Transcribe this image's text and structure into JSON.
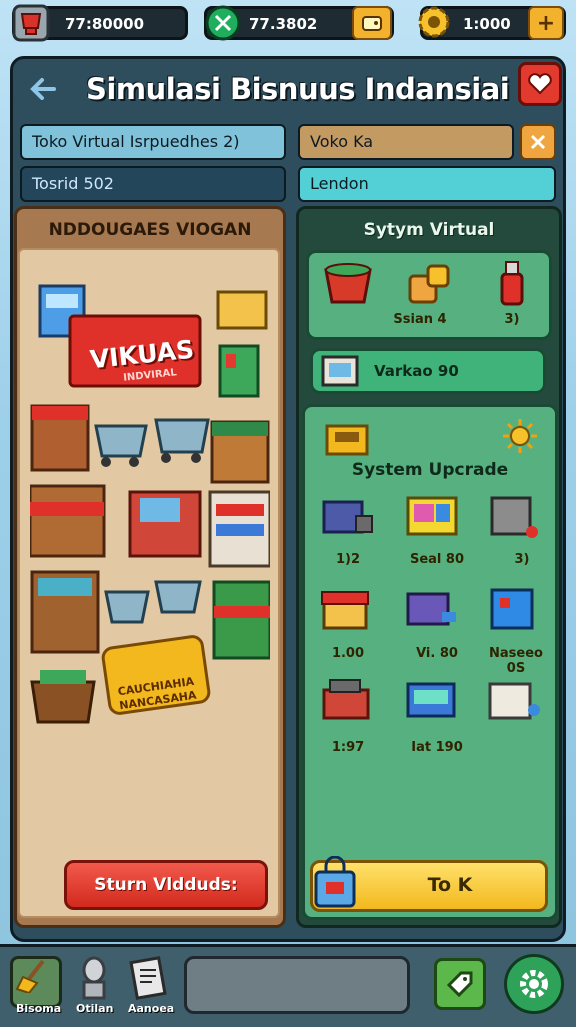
{
  "topbar": {
    "res1_value": "77:80000",
    "res2_value": "77.3802",
    "res3_value": "1:000"
  },
  "header": {
    "title": "Simulasi Bisnuus Indansiai"
  },
  "fields": {
    "store_name": "Toko Virtual Isrpuedhes 2)",
    "right_name": "Voko Ka",
    "secondary": "Tosrid 502",
    "location": "Lendon"
  },
  "left_panel": {
    "title": "NDDOUGAES VIOGAN",
    "banner_text": "VIKUAS",
    "banner_sub": "INDVIRAL",
    "sign_text": "CAUCHIAHIA NANCASAHA",
    "button_label": "Sturn Vldduds:"
  },
  "right_panel": {
    "section_title": "Sytym Virtual",
    "top_items": [
      {
        "label": ""
      },
      {
        "label": "Ssian 4"
      },
      {
        "label": "3)"
      }
    ],
    "wide_item_label": "Varkao 90",
    "upgrade_title": "System Upcrade",
    "upgrades": [
      {
        "label": "1)2"
      },
      {
        "label": "Seal 80"
      },
      {
        "label": "3)"
      },
      {
        "label": "1.00"
      },
      {
        "label": "Vi. 80"
      },
      {
        "label": "Naseeo 0S"
      },
      {
        "label": "1:97"
      },
      {
        "label": "Iat 190"
      },
      {
        "label": ""
      }
    ],
    "confirm_label": "To K"
  },
  "bottom_bar": {
    "tabs": [
      {
        "label": "Bisoma"
      },
      {
        "label": "Otilan"
      },
      {
        "label": "Aanoea"
      }
    ]
  },
  "colors": {
    "frame": "#2e4e5e",
    "left_panel": "#a77950",
    "right_panel": "#244a3e",
    "accent_red": "#d22a1e",
    "accent_yellow": "#f2b81e"
  }
}
